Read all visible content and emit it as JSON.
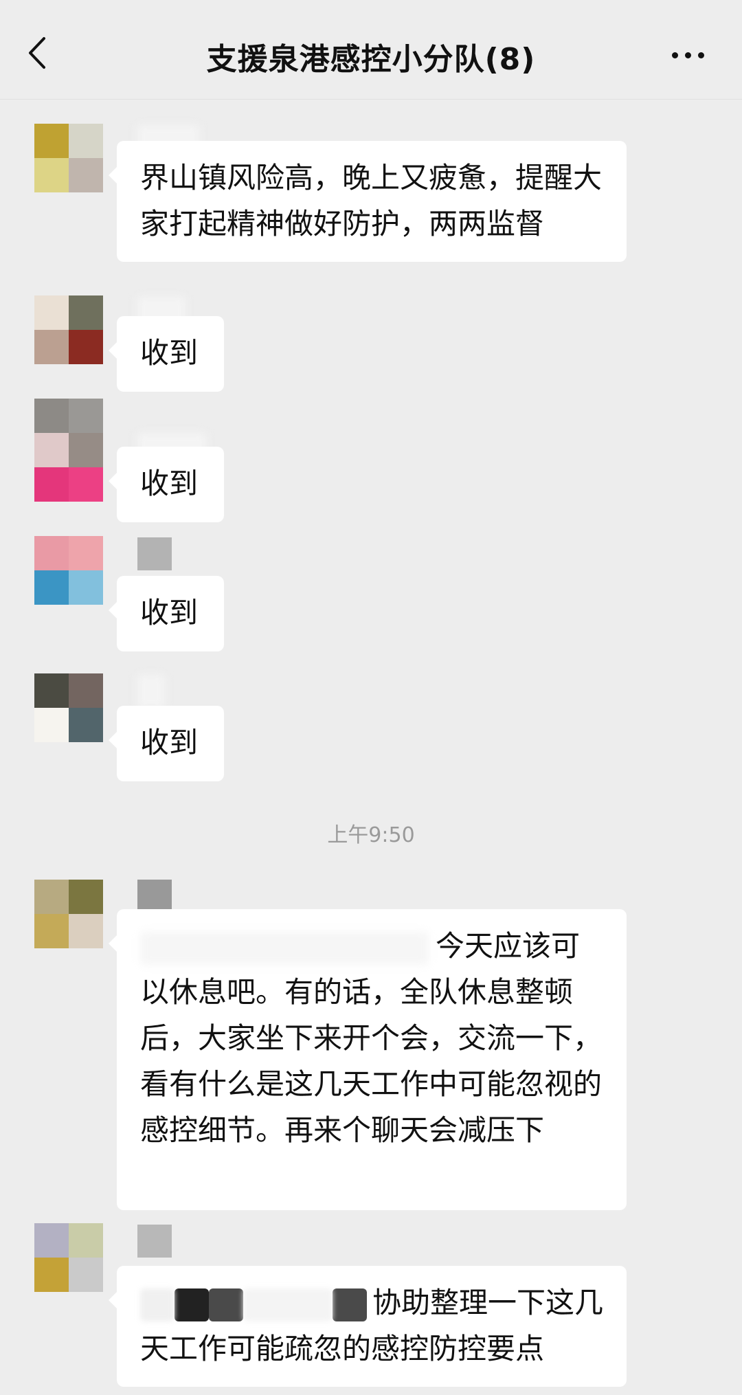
{
  "header": {
    "title": "支援泉港感控小分队(8)",
    "back_icon": "chevron-left-icon",
    "more_icon": "more-icon"
  },
  "messages": [
    {
      "text": "界山镇风险高，晚上又疲惫，提醒大家打起精神做好防护，两两监督"
    },
    {
      "text": "收到"
    },
    {
      "text": "收到"
    },
    {
      "text": "收到"
    },
    {
      "text": "收到"
    },
    {
      "text": "今天应该可以休息吧。有的话，全队休息整顿后，大家坐下来开个会，交流一下，看有什么是这几天工作中可能忽视的感控细节。再来个聊天会减压下"
    },
    {
      "text": "协助整理一下这几天工作可能疏忽的感控防控要点"
    }
  ],
  "timestamp": "上午9:50"
}
